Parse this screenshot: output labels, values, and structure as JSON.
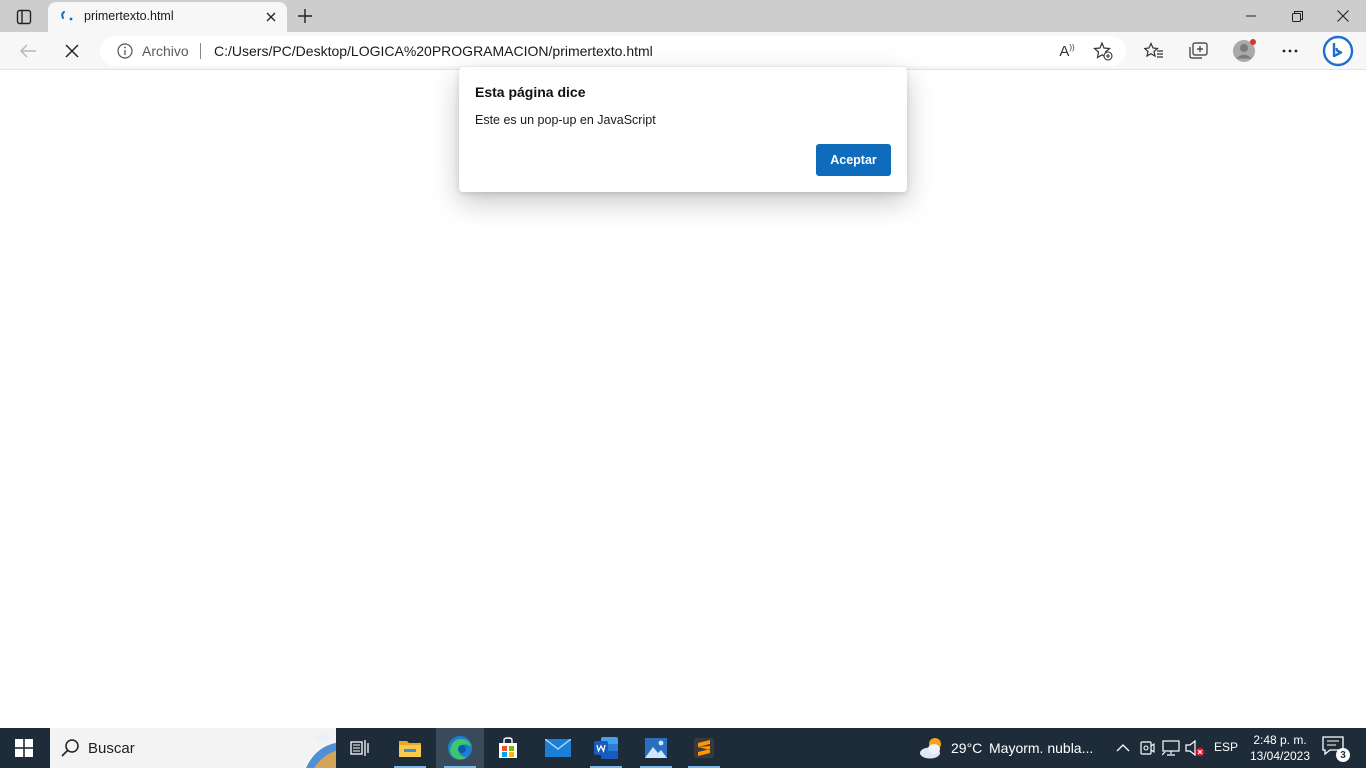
{
  "browser": {
    "tab": {
      "title": "primertexto.html"
    },
    "address": {
      "scheme_label": "Archivo",
      "url": "C:/Users/PC/Desktop/LOGICA%20PROGRAMACION/primertexto.html"
    },
    "read_aloud_label": "A"
  },
  "dialog": {
    "title": "Esta página dice",
    "message": "Este es un pop-up en JavaScript",
    "ok_label": "Aceptar",
    "accent_color": "#0f6cbd"
  },
  "taskbar": {
    "search_placeholder": "Buscar",
    "apps": [
      "task-view-icon",
      "file-explorer-icon",
      "edge-icon",
      "store-icon",
      "mail-icon",
      "word-icon",
      "photos-icon",
      "sublime-text-icon"
    ],
    "weather": {
      "temp": "29°C",
      "desc": "Mayorm. nubla..."
    },
    "language": "ESP",
    "time": "2:48 p. m.",
    "date": "13/04/2023",
    "notifications": "3"
  }
}
